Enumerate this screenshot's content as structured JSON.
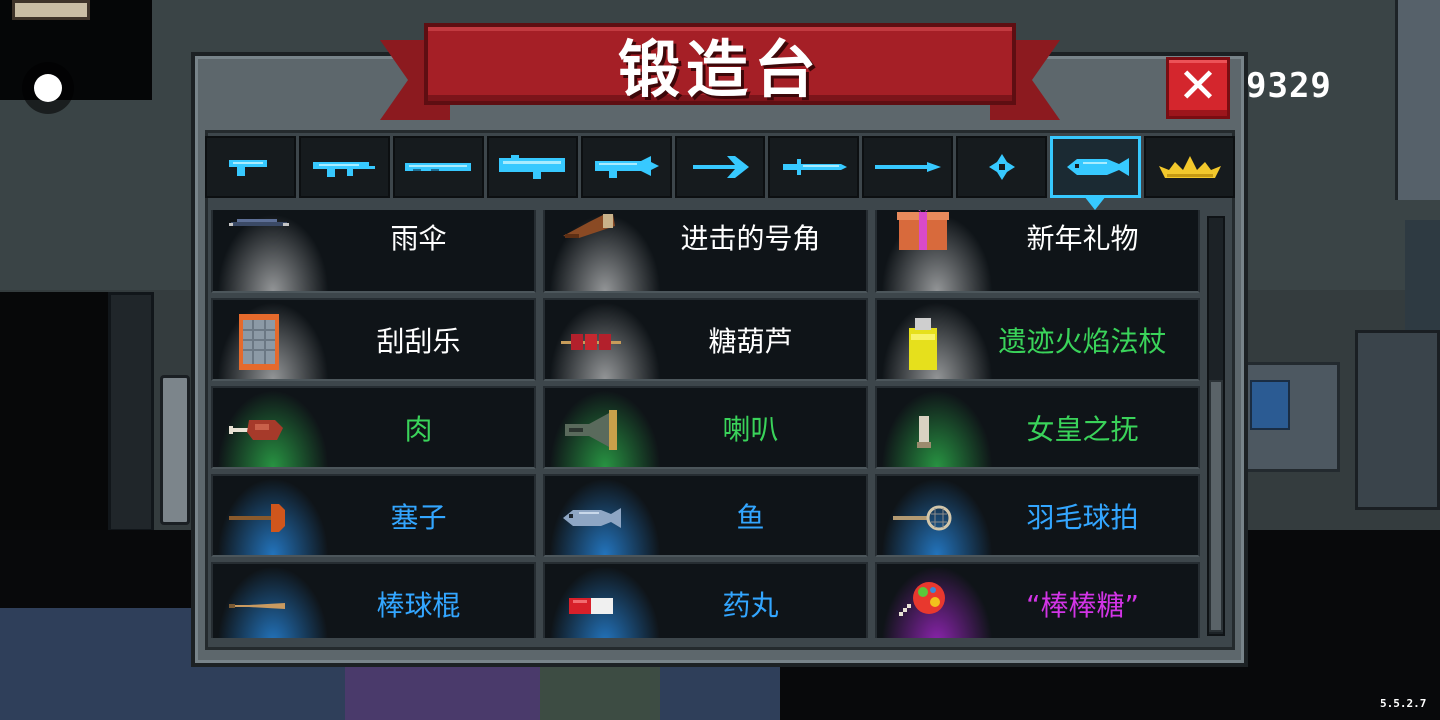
{
  "title": "锻造台",
  "close_label": "✕",
  "coin_count": "9329",
  "version": "5.5.2.7",
  "accent_color": "#37c9ff",
  "tabs": [
    {
      "icon": "pistol-icon",
      "active": false
    },
    {
      "icon": "assault-rifle-icon",
      "active": false
    },
    {
      "icon": "shotgun-icon",
      "active": false
    },
    {
      "icon": "rocket-launcher-icon",
      "active": false
    },
    {
      "icon": "laser-gun-icon",
      "active": false
    },
    {
      "icon": "bow-icon",
      "active": false
    },
    {
      "icon": "sword-icon",
      "active": false
    },
    {
      "icon": "spear-icon",
      "active": false
    },
    {
      "icon": "shuriken-icon",
      "active": false
    },
    {
      "icon": "fish-icon",
      "active": true
    },
    {
      "icon": "crown-icon",
      "active": false
    }
  ],
  "items": [
    {
      "label": "雨伞",
      "rarity": "white",
      "icon": "umbrella-icon"
    },
    {
      "label": "进击的号角",
      "rarity": "white",
      "icon": "horn-icon"
    },
    {
      "label": "新年礼物",
      "rarity": "white",
      "icon": "gift-icon"
    },
    {
      "label": "刮刮乐",
      "rarity": "white",
      "icon": "scratch-card-icon"
    },
    {
      "label": "糖葫芦",
      "rarity": "white",
      "icon": "candied-haws-icon"
    },
    {
      "label": "遗迹火焰法杖",
      "rarity": "green",
      "icon": "flame-staff-icon"
    },
    {
      "label": "肉",
      "rarity": "green",
      "icon": "meat-icon"
    },
    {
      "label": "喇叭",
      "rarity": "green",
      "icon": "megaphone-icon"
    },
    {
      "label": "女皇之抚",
      "rarity": "green",
      "icon": "empress-touch-icon"
    },
    {
      "label": "塞子",
      "rarity": "blue",
      "icon": "plunger-icon"
    },
    {
      "label": "鱼",
      "rarity": "blue",
      "icon": "fish-icon"
    },
    {
      "label": "羽毛球拍",
      "rarity": "blue",
      "icon": "badminton-racket-icon"
    },
    {
      "label": "棒球棍",
      "rarity": "blue",
      "icon": "baseball-bat-icon"
    },
    {
      "label": "药丸",
      "rarity": "blue",
      "icon": "pill-icon"
    },
    {
      "label": "“棒棒糖”",
      "rarity": "purple",
      "icon": "lollipop-icon"
    }
  ]
}
